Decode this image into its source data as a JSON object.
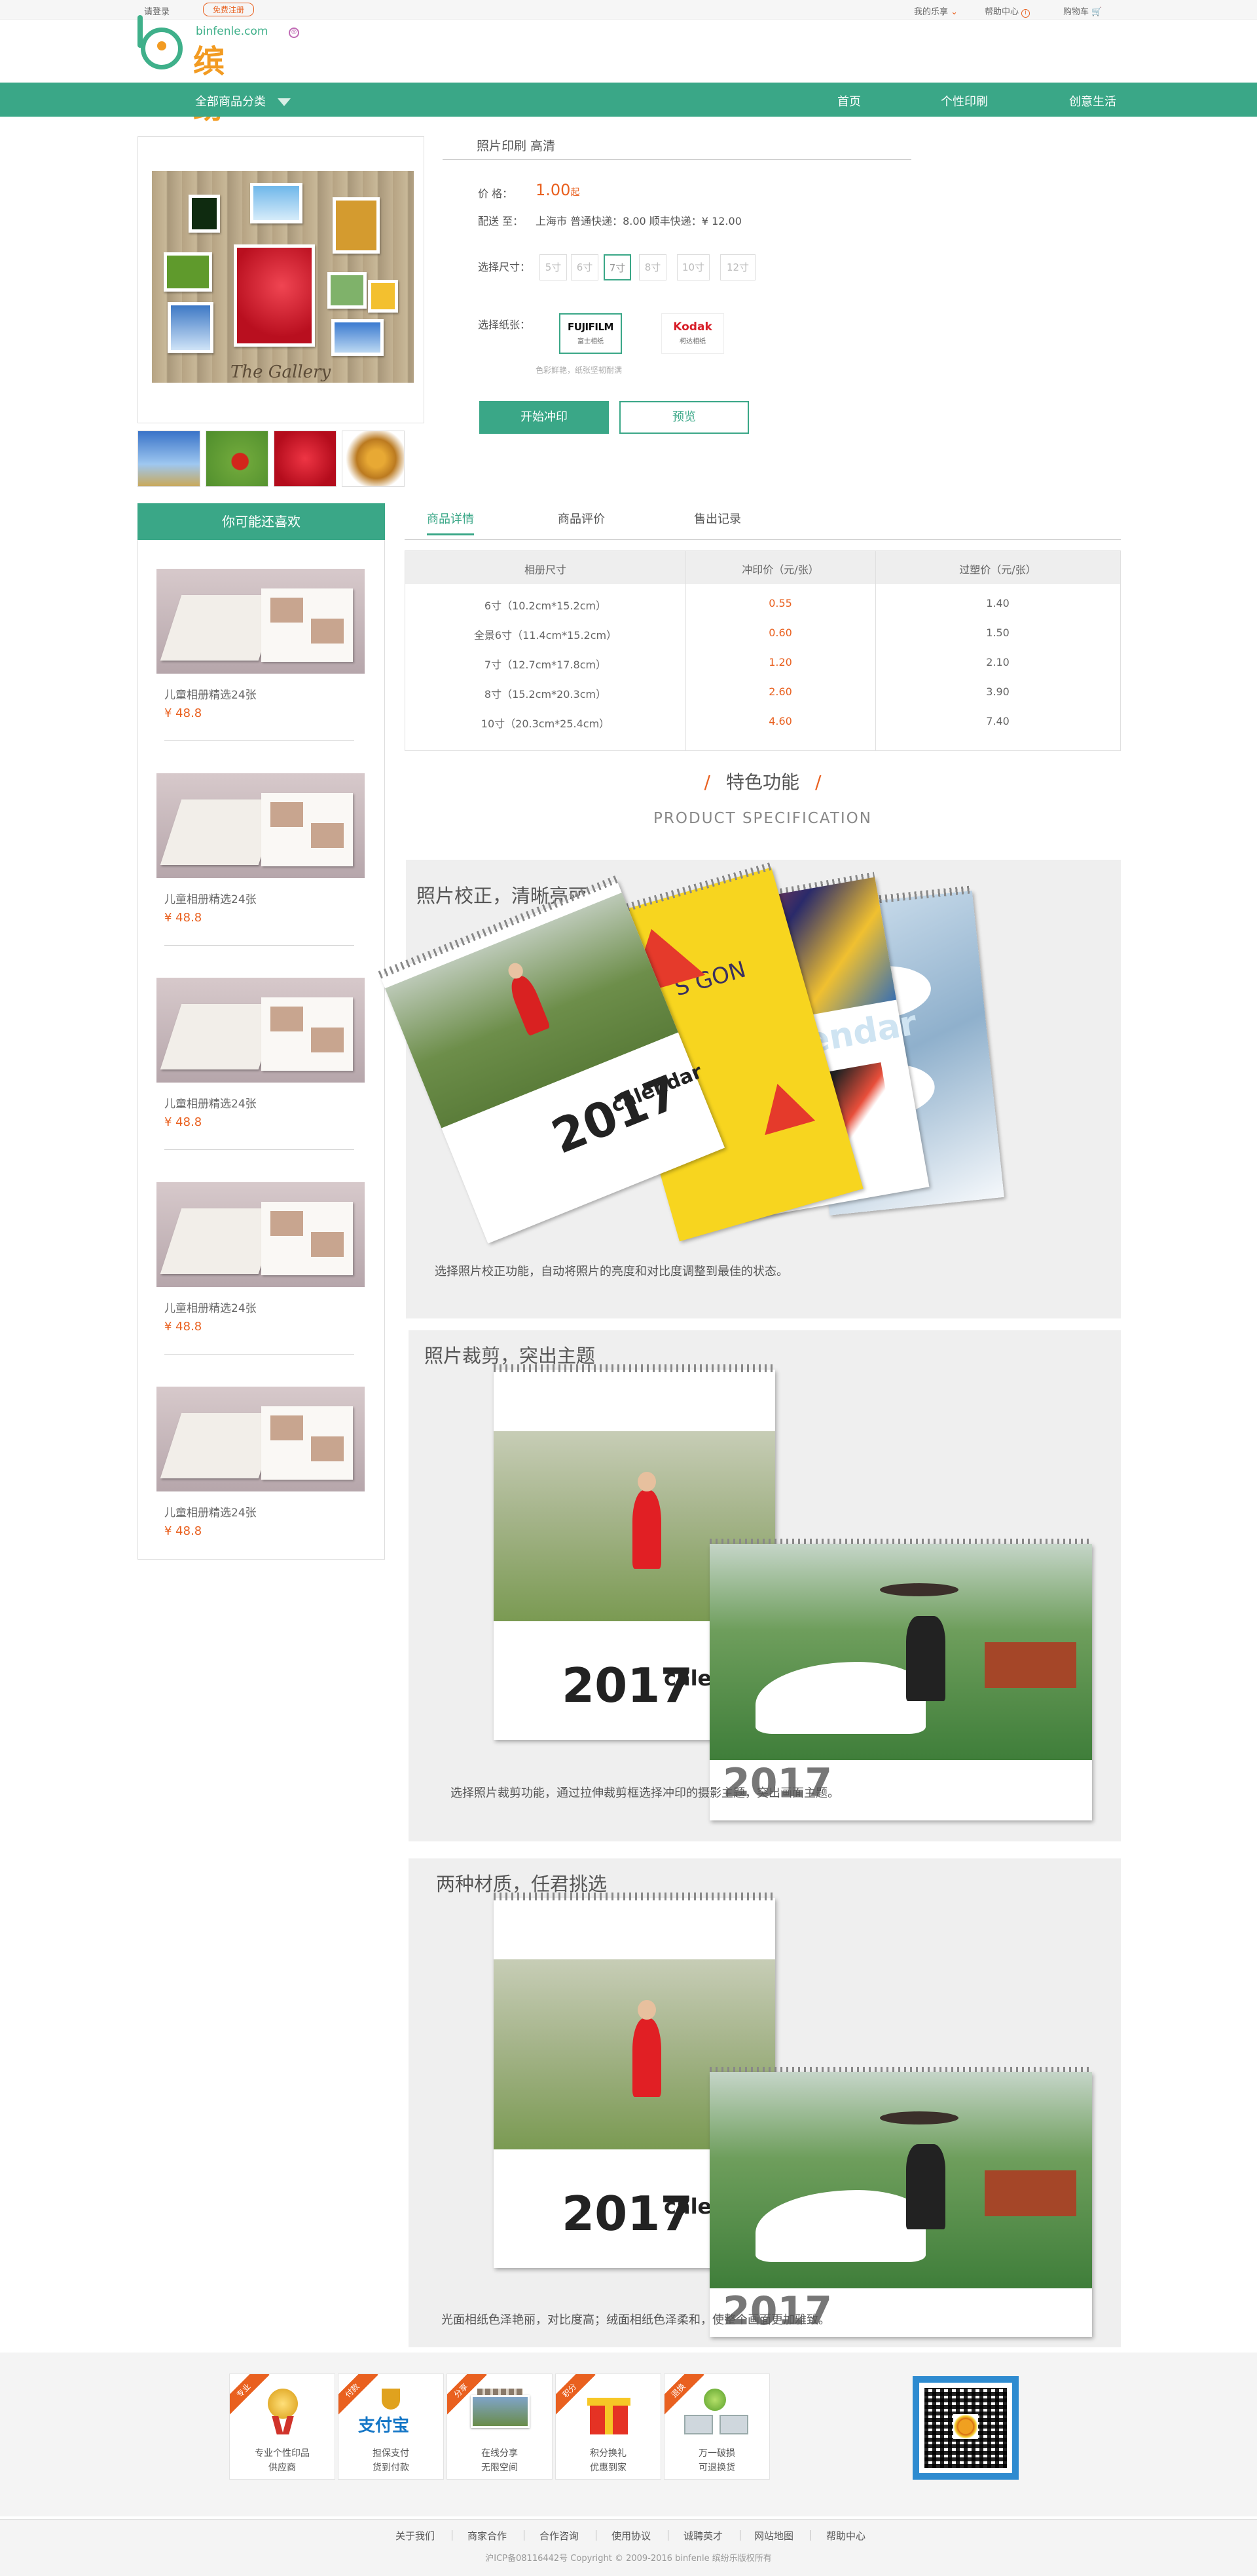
{
  "topbar": {
    "login": "请登录",
    "register": "免费注册",
    "my_account": "我的乐享",
    "help": "帮助中心",
    "cart": "购物车"
  },
  "logo": {
    "domain": "binfenle.com",
    "name": "缤纷乐",
    "reg_mark": "®"
  },
  "nav": {
    "all_categories": "全部商品分类",
    "items": [
      "首页",
      "个性印刷",
      "创意生活"
    ]
  },
  "product": {
    "title": "照片印刷  高清",
    "price_label": "价    格：",
    "price": "1.00",
    "price_suffix": "起",
    "shipping_label": "配送 至：",
    "shipping": "上海市 普通快递：8.00 顺丰快递：¥ 12.00",
    "size_label": "选择尺寸：",
    "sizes": [
      "5寸",
      "6寸",
      "7寸",
      "8寸",
      "10寸",
      "12寸"
    ],
    "selected_size_index": 2,
    "paper_label": "选择纸张：",
    "papers": [
      {
        "brand": "FUJIFILM",
        "sub": "富士相纸"
      },
      {
        "brand": "Kodak",
        "sub": "柯达相纸"
      }
    ],
    "paper_note": "色彩鲜艳，纸张坚韧耐满",
    "print_button": "开始冲印",
    "preview_button": "预览"
  },
  "sidebar": {
    "title": "你可能还喜欢",
    "items": [
      {
        "name": "儿童相册精选24张",
        "price": "¥ 48.8"
      },
      {
        "name": "儿童相册精选24张",
        "price": "¥ 48.8"
      },
      {
        "name": "儿童相册精选24张",
        "price": "¥ 48.8"
      },
      {
        "name": "儿童相册精选24张",
        "price": "¥ 48.8"
      },
      {
        "name": "儿童相册精选24张",
        "price": "¥ 48.8"
      }
    ]
  },
  "tabs": [
    "商品详情",
    "商品评价",
    "售出记录"
  ],
  "price_table": {
    "headers": [
      "相册尺寸",
      "冲印价（元/张）",
      "过塑价（元/张）"
    ],
    "rows": [
      [
        "6寸（10.2cm*15.2cm）",
        "0.55",
        "1.40"
      ],
      [
        "全景6寸（11.4cm*15.2cm）",
        "0.60",
        "1.50"
      ],
      [
        "7寸（12.7cm*17.8cm）",
        "1.20",
        "2.10"
      ],
      [
        "8寸（15.2cm*20.3cm）",
        "2.60",
        "3.90"
      ],
      [
        "10寸（20.3cm*25.4cm）",
        "4.60",
        "7.40"
      ]
    ]
  },
  "features": {
    "title": "特色功能",
    "slash": "/",
    "subtitle": "PRODUCT SPECIFICATION",
    "panels": [
      {
        "title": "照片校正，清晰亮丽",
        "caption": "选择照片校正功能，自动将照片的亮度和对比度调整到最佳的状态。"
      },
      {
        "title": "照片裁剪，突出主题",
        "caption": "选择照片裁剪功能，通过拉伸裁剪框选择冲印的摄影主题，突出画面主题。"
      },
      {
        "title": "两种材质，任君挑选",
        "caption": "光面相纸色泽艳丽，对比度高；绒面相纸色泽柔和，使整个画面更加雅致。"
      }
    ],
    "calendar_word": "calendar",
    "calendar_year": "2017"
  },
  "footer": {
    "boxes": [
      {
        "ribbon": "专业",
        "text": "专业个性印品\n供应商"
      },
      {
        "ribbon": "付款",
        "text": "担保支付\n货到付款"
      },
      {
        "ribbon": "分享",
        "text": "在线分享\n无限空间"
      },
      {
        "ribbon": "积分",
        "text": "积分换礼\n优惠到家"
      },
      {
        "ribbon": "退换",
        "text": "万一破损\n可退换货"
      }
    ],
    "links": [
      "关于我们",
      "商家合作",
      "合作咨询",
      "使用协议",
      "诚聘英才",
      "网站地图",
      "帮助中心"
    ],
    "copyright": "沪ICP备08116442号 Copyright © 2009-2016 binfenle 缤纷乐版权所有"
  },
  "colors": {
    "accent": "#3aa787",
    "price": "#e9601f",
    "logo_orange": "#f29b22"
  }
}
